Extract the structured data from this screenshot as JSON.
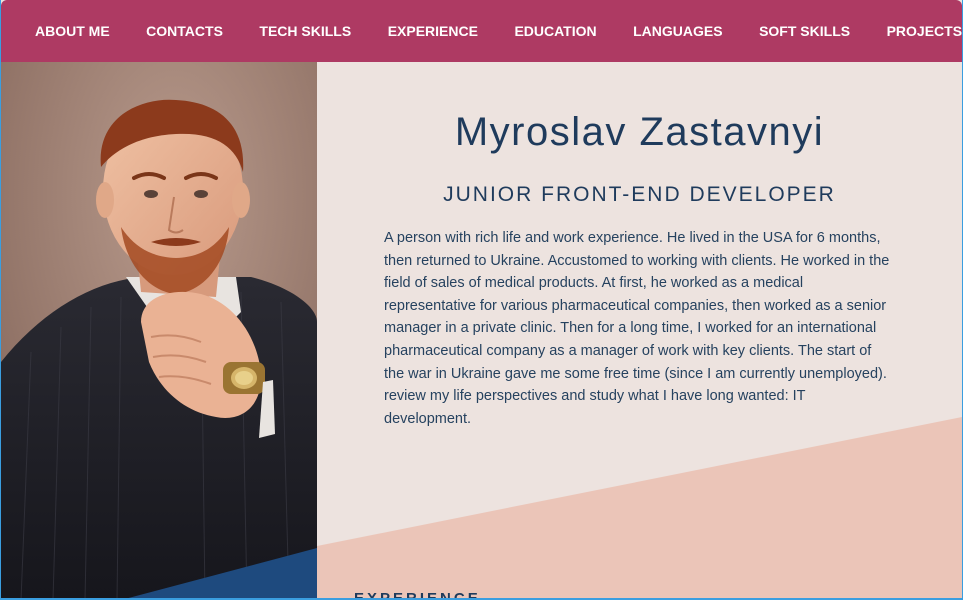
{
  "nav": {
    "items": [
      {
        "label": "ABOUT ME"
      },
      {
        "label": "CONTACTS"
      },
      {
        "label": "TECH SKILLS"
      },
      {
        "label": "EXPERIENCE"
      },
      {
        "label": "EDUCATION"
      },
      {
        "label": "LANGUAGES"
      },
      {
        "label": "SOFT SKILLS"
      },
      {
        "label": "PROJECTS"
      }
    ]
  },
  "profile": {
    "name": "Myroslav Zastavnyi",
    "role": "JUNIOR FRONT-END DEVELOPER",
    "bio": "A person with rich life and work experience. He lived in the USA for 6 months, then returned to Ukraine. Accustomed to working with clients. He worked in the field of sales of medical products. At first, he worked as a medical representative for various pharmaceutical companies, then worked as a senior manager in a private clinic. Then for a long time, I worked for an international pharmaceutical company as a manager of work with key clients. The start of the war in Ukraine gave me some free time (since I am currently unemployed). review my life perspectives and study what I have long wanted: IT development."
  },
  "sections": {
    "experience_heading": "EXPERIENCE"
  },
  "colors": {
    "nav_bg": "#ae3a63",
    "nav_text": "#ffffff",
    "content_bg": "#ede3df",
    "accent_diagonal": "#ebc5b8",
    "text_primary": "#1f3b5c",
    "photo_corner": "#1e4a7e"
  }
}
